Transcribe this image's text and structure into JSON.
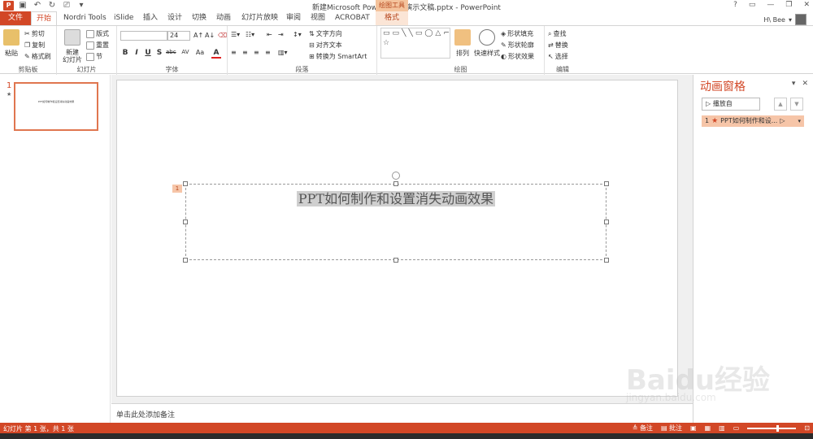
{
  "window": {
    "title": "新建Microsoft PowerPoint 演示文稿.pptx - PowerPoint",
    "context_tools": "绘图工具",
    "buttons": [
      "?",
      "▭",
      "—",
      "❐",
      "✕"
    ]
  },
  "user": {
    "name": "H\\ Bee"
  },
  "tabs": [
    "文件",
    "开始",
    "Nordri Tools",
    "iSlide",
    "插入",
    "设计",
    "切换",
    "动画",
    "幻灯片放映",
    "审阅",
    "视图",
    "ACROBAT",
    "格式"
  ],
  "ribbon": {
    "clipboard": {
      "label": "剪贴板",
      "paste": "粘贴",
      "cut": "剪切",
      "copy": "复制",
      "format_painter": "格式刷"
    },
    "slides": {
      "label": "幻灯片",
      "new_slide": "新建\n幻灯片",
      "layout": "版式",
      "reset": "重置",
      "section": "节"
    },
    "font": {
      "label": "字体",
      "font_name": "",
      "font_size": "24",
      "bold": "B",
      "italic": "I",
      "underline": "U",
      "shadow": "S",
      "strike": "abc",
      "spacing": "AV",
      "case": "Aa",
      "color": "A"
    },
    "paragraph": {
      "label": "段落",
      "text_direction": "文字方向",
      "align_text": "对齐文本",
      "smartart": "转换为 SmartArt"
    },
    "drawing": {
      "label": "绘图",
      "arrange": "排列",
      "quick_styles": "快速样式",
      "shape_fill": "形状填充",
      "shape_outline": "形状轮廓",
      "shape_effects": "形状效果"
    },
    "editing": {
      "label": "编辑",
      "find": "查找",
      "replace": "替换",
      "select": "选择"
    }
  },
  "thumbnail": {
    "number": "1",
    "star": "★",
    "text": "PPT如何制作和设置消失动画效果"
  },
  "slide": {
    "title": "PPT如何制作和设置消失动画效果",
    "anim_tag": "1"
  },
  "notes": {
    "placeholder": "单击此处添加备注",
    "page": "0"
  },
  "anim_pane": {
    "title": "动画窗格",
    "play_from": "播放自",
    "item_index": "1",
    "item_label": "PPT如何制作和设..."
  },
  "statusbar": {
    "slide_info": "幻灯片 第 1 张，共 1 张",
    "notes": "备注",
    "comments": "批注"
  },
  "watermark": {
    "main": "Baidu经验",
    "sub": "jingyan.baidu.com"
  },
  "colors": {
    "accent": "#d24726",
    "accent_light": "#f6c5a8",
    "format_tab": "#fbe5d6"
  }
}
